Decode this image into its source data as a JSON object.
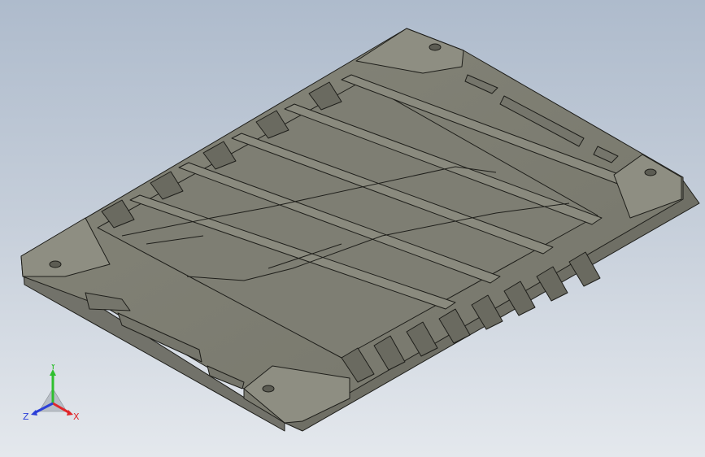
{
  "viewport": {
    "background_top": "#aebbcc",
    "background_bottom": "#e4e8ed"
  },
  "model": {
    "body_color": "#85857a",
    "top_color": "#7b7b6f",
    "edge_color": "#1e1e1a"
  },
  "triad": {
    "x_label": "X",
    "y_label": "Y",
    "z_label": "Z",
    "x_color": "#e0262a",
    "y_color": "#2fbf2f",
    "z_color": "#2b3fd8"
  }
}
